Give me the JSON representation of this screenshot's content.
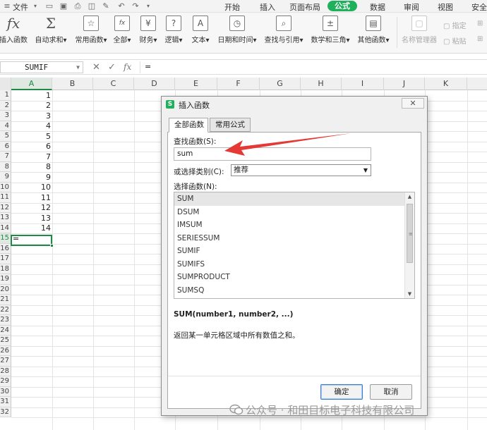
{
  "menubar": {
    "file": "文件",
    "tabs": [
      "开始",
      "插入",
      "页面布局",
      "公式",
      "数据",
      "审阅",
      "视图",
      "安全"
    ],
    "active_tab": "公式"
  },
  "ribbon": {
    "insert_function": "插入函数",
    "autosum": "自动求和",
    "common_functions": "常用函数",
    "all": "全部",
    "finance": "财务",
    "logic": "逻辑",
    "text": "文本",
    "datetime": "日期和时间",
    "lookup": "查找与引用",
    "math": "数学和三角",
    "other": "其他函数",
    "name_manager": "名称管理器",
    "specify": "指定",
    "paste": "粘贴"
  },
  "formula_bar": {
    "name_box": "SUMIF",
    "content": "=",
    "fx": "fx"
  },
  "sheet": {
    "columns": [
      "A",
      "B",
      "C",
      "D",
      "E",
      "F",
      "G",
      "H",
      "I",
      "J",
      "K"
    ],
    "rows": [
      "1",
      "2",
      "3",
      "4",
      "5",
      "6",
      "7",
      "8",
      "9",
      "10",
      "11",
      "12",
      "13",
      "14",
      "15",
      "16",
      "17",
      "18",
      "19",
      "20",
      "21",
      "22",
      "23",
      "24",
      "25",
      "26",
      "27",
      "28",
      "29",
      "30",
      "31",
      "32"
    ],
    "values": [
      "1",
      "2",
      "3",
      "4",
      "5",
      "6",
      "7",
      "8",
      "9",
      "10",
      "11",
      "12",
      "13",
      "14"
    ],
    "active_cell_value": "="
  },
  "dialog": {
    "title": "插入函数",
    "close": "✕",
    "tabs": [
      "全部函数",
      "常用公式"
    ],
    "search_label": "查找函数(S):",
    "search_value": "sum",
    "category_label": "或选择类别(C):",
    "category_value": "推荐",
    "list_label": "选择函数(N):",
    "functions": [
      "SUM",
      "DSUM",
      "IMSUM",
      "SERIESSUM",
      "SUMIF",
      "SUMIFS",
      "SUMPRODUCT",
      "SUMSQ"
    ],
    "selected_function": "SUM",
    "syntax": "SUM(number1, number2, ...)",
    "description": "返回某一单元格区域中所有数值之和。",
    "ok": "确定",
    "cancel": "取消"
  },
  "watermark": "公众号 · 和田目标电子科技有限公司",
  "colors": {
    "accent": "#1eb05a",
    "selection": "#1e8a45",
    "arrow": "#e53935"
  }
}
